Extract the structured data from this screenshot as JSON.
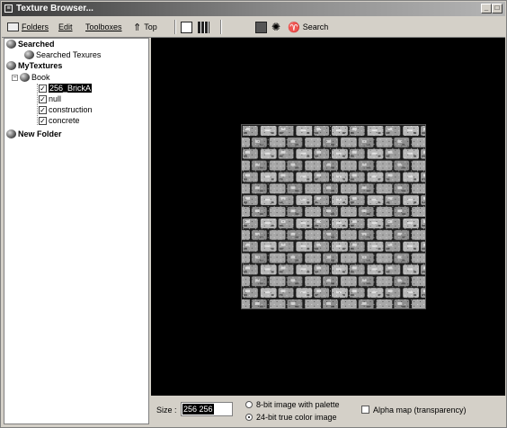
{
  "window": {
    "title": "Texture Browser..."
  },
  "toolbar": {
    "folders_label": "Folders",
    "edit_label": "Edit",
    "toolboxes_label": "Toolboxes",
    "top_label": "Top",
    "search_label": "Search"
  },
  "tree": {
    "searched": "Searched",
    "searched_child": "Searched Texures",
    "mytextures": "MyTextures",
    "book": "Book",
    "items": [
      "256_BrickA",
      "null",
      "construction",
      "concrete"
    ],
    "new_folder": "New Folder"
  },
  "bottom": {
    "size_label": "Size :",
    "size_value": "256 256",
    "option_8bit": "8-bit image with palette",
    "option_24bit": "24-bit true color image",
    "alpha_label": "Alpha map (transparency)"
  },
  "icons": [
    "folder-icon",
    "top-arrow-icon",
    "edit-icon",
    "grid-icon",
    "texture-icon",
    "gear-icon",
    "binoculars-icon",
    "globe-icon",
    "checkbox-icon"
  ]
}
